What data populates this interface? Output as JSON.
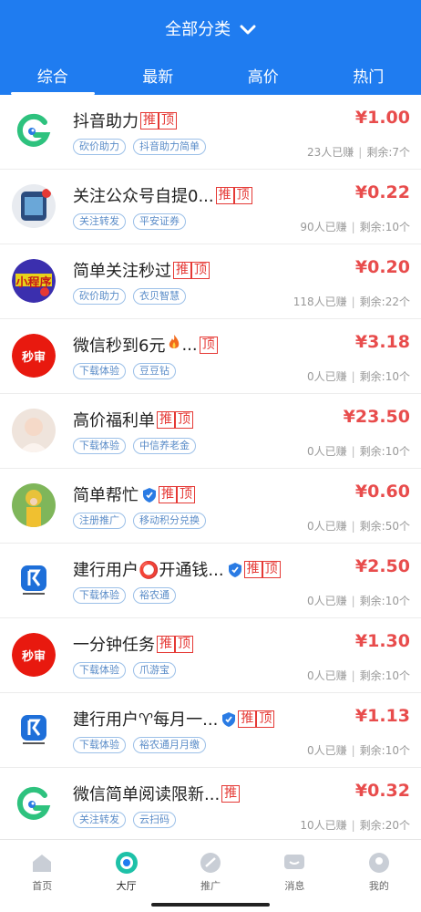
{
  "header": {
    "title": "全部分类",
    "tabs": [
      {
        "label": "综合",
        "active": true
      },
      {
        "label": "最新",
        "active": false
      },
      {
        "label": "高价",
        "active": false
      },
      {
        "label": "热门",
        "active": false
      }
    ]
  },
  "items": [
    {
      "name": "抖音助力",
      "badges": [
        "推",
        "顶"
      ],
      "tags": [
        "砍价助力",
        "抖音助力简单"
      ],
      "price": "¥1.00",
      "earned": "23人已赚",
      "remaining": "剩余:7个",
      "avatar": "green-g-logo"
    },
    {
      "name": "关注公众号自提0...",
      "badges": [
        "推",
        "顶"
      ],
      "tags": [
        "关注转发",
        "平安证券"
      ],
      "price": "¥0.22",
      "earned": "90人已赚",
      "remaining": "剩余:10个",
      "avatar": "app-photo"
    },
    {
      "name": "简单关注秒过",
      "badges": [
        "推",
        "顶"
      ],
      "tags": [
        "砍价助力",
        "衣贝智慧"
      ],
      "price": "¥0.20",
      "earned": "118人已赚",
      "remaining": "剩余:22个",
      "avatar": "mini-program-logo",
      "avatar_text": "小程序"
    },
    {
      "name": "微信秒到6元",
      "fire": true,
      "suffix": "...",
      "badges": [
        "顶"
      ],
      "tags": [
        "下载体验",
        "豆豆钻"
      ],
      "price": "¥3.18",
      "earned": "0人已赚",
      "remaining": "剩余:10个",
      "avatar": "miaoshen-logo",
      "avatar_text": "秒审"
    },
    {
      "name": "高价福利单",
      "badges": [
        "推",
        "顶"
      ],
      "tags": [
        "下载体验",
        "中信养老金"
      ],
      "price": "¥23.50",
      "earned": "0人已赚",
      "remaining": "剩余:10个",
      "avatar": "portrait-photo"
    },
    {
      "name": "简单帮忙",
      "shield": true,
      "badges": [
        "推",
        "顶"
      ],
      "tags": [
        "注册推广",
        "移动积分兑换"
      ],
      "price": "¥0.60",
      "earned": "0人已赚",
      "remaining": "剩余:50个",
      "avatar": "sunflower-photo"
    },
    {
      "name": "建行用户⭕开通钱...",
      "shield": true,
      "badges": [
        "推",
        "顶"
      ],
      "tags": [
        "下载体验",
        "裕农通"
      ],
      "price": "¥2.50",
      "earned": "0人已赚",
      "remaining": "剩余:10个",
      "avatar": "bank-logo"
    },
    {
      "name": "一分钟任务",
      "badges": [
        "推",
        "顶"
      ],
      "tags": [
        "下载体验",
        "爪游宝"
      ],
      "price": "¥1.30",
      "earned": "0人已赚",
      "remaining": "剩余:10个",
      "avatar": "miaoshen-logo",
      "avatar_text": "秒审"
    },
    {
      "name": "建行用户♈每月一...",
      "shield": true,
      "badges": [
        "推",
        "顶"
      ],
      "tags": [
        "下载体验",
        "裕农通月月缴"
      ],
      "price": "¥1.13",
      "earned": "0人已赚",
      "remaining": "剩余:10个",
      "avatar": "bank-logo"
    },
    {
      "name": "微信简单阅读限新...",
      "badges": [
        "推"
      ],
      "tags": [
        "关注转发",
        "云扫码"
      ],
      "price": "¥0.32",
      "earned": "10人已赚",
      "remaining": "剩余:20个",
      "avatar": "green-g-logo"
    }
  ],
  "tabbar": [
    {
      "label": "首页",
      "icon": "home-icon",
      "active": false
    },
    {
      "label": "大厅",
      "icon": "hall-icon",
      "active": true
    },
    {
      "label": "推广",
      "icon": "promote-icon",
      "active": false
    },
    {
      "label": "消息",
      "icon": "message-icon",
      "active": false
    },
    {
      "label": "我的",
      "icon": "profile-icon",
      "active": false
    }
  ],
  "colors": {
    "primary": "#1f7cf0",
    "price": "#e84c4c",
    "badge": "#e53935",
    "tag": "#5a8cc8"
  }
}
